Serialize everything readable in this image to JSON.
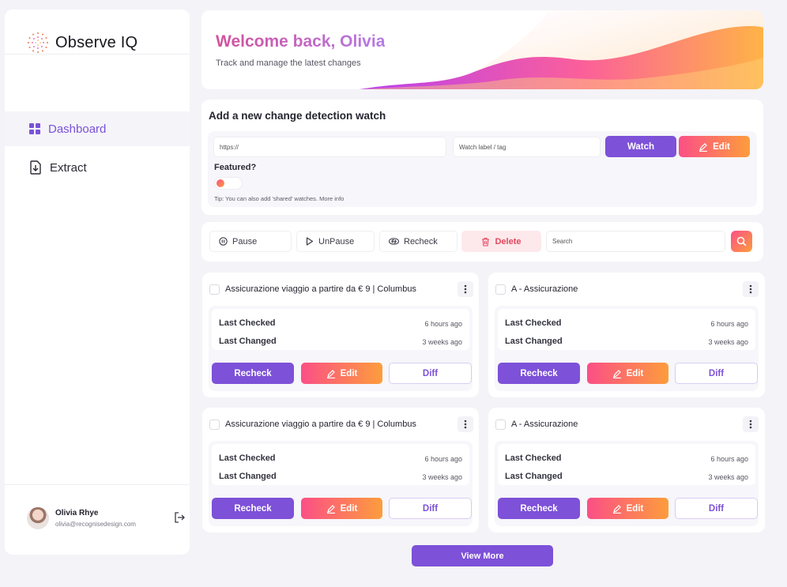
{
  "brand": {
    "name": "Observe IQ",
    "icon": "dotted-sun-logo"
  },
  "sidebar": {
    "items": [
      {
        "label": "Dashboard",
        "icon": "grid-icon",
        "active": true
      },
      {
        "label": "Extract",
        "icon": "file-download-icon",
        "active": false
      }
    ],
    "user": {
      "name": "Olivia Rhye",
      "email": "olivia@recognisedesign.com"
    }
  },
  "hero": {
    "title": "Welcome back, Olivia",
    "subtitle": "Track and manage the latest changes"
  },
  "add_watch": {
    "title": "Add a new change detection watch",
    "url_placeholder": "https://",
    "label_placeholder": "Watch label / tag",
    "watch_label": "Watch",
    "edit_label": "Edit",
    "featured_label": "Featured?",
    "tip": "Tip: You can also add 'shared' watches. More info"
  },
  "toolbar": {
    "pause": "Pause",
    "unpause": "UnPause",
    "recheck": "Recheck",
    "delete": "Delete",
    "search_placeholder": "Search"
  },
  "cards": [
    {
      "title": "Assicurazione viaggio a partire da € 9 | Columbus",
      "last_checked_label": "Last Checked",
      "last_checked": "6 hours ago",
      "last_changed_label": "Last Changed",
      "last_changed": "3 weeks ago",
      "recheck": "Recheck",
      "edit": "Edit",
      "diff": "Diff"
    },
    {
      "title": "A - Assicurazione",
      "last_checked_label": "Last Checked",
      "last_checked": "6 hours ago",
      "last_changed_label": "Last Changed",
      "last_changed": "3 weeks ago",
      "recheck": "Recheck",
      "edit": "Edit",
      "diff": "Diff"
    },
    {
      "title": "Assicurazione viaggio a partire da € 9 | Columbus",
      "last_checked_label": "Last Checked",
      "last_checked": "6 hours ago",
      "last_changed_label": "Last Changed",
      "last_changed": "3 weeks ago",
      "recheck": "Recheck",
      "edit": "Edit",
      "diff": "Diff"
    },
    {
      "title": "A - Assicurazione",
      "last_checked_label": "Last Checked",
      "last_checked": "6 hours ago",
      "last_changed_label": "Last Changed",
      "last_changed": "3 weeks ago",
      "recheck": "Recheck",
      "edit": "Edit",
      "diff": "Diff"
    }
  ],
  "view_more": "View More",
  "colors": {
    "accent": "#7d51d8",
    "gradient_start": "#fb4f86",
    "gradient_end": "#fd9d3c",
    "danger": "#e5475f"
  }
}
